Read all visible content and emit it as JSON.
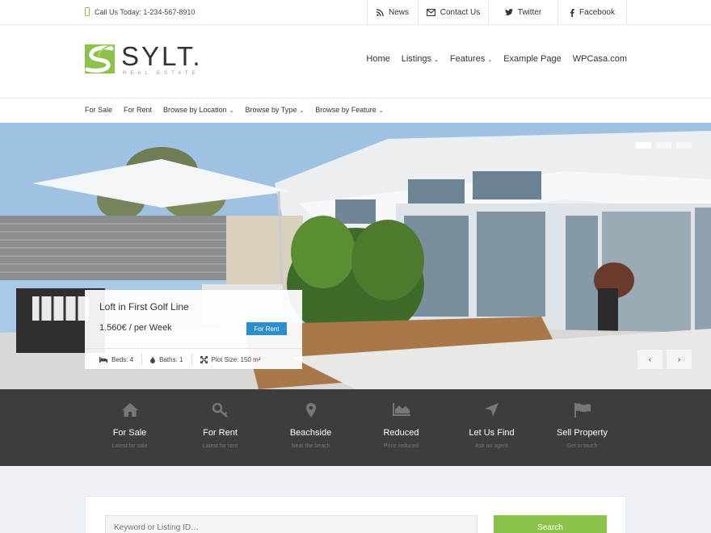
{
  "topbar": {
    "phone": "Call Us Today: 1-234-567-8910",
    "links": [
      {
        "label": "News",
        "icon": "rss-icon"
      },
      {
        "label": "Contact Us",
        "icon": "envelope-icon"
      },
      {
        "label": "Twitter",
        "icon": "twitter-icon"
      },
      {
        "label": "Facebook",
        "icon": "facebook-icon"
      }
    ]
  },
  "logo": {
    "title": "SYLT.",
    "subtitle": "REAL ESTATE"
  },
  "mainnav": [
    "Home",
    "Listings",
    "Features",
    "Example Page",
    "WPCasa.com"
  ],
  "subnav": [
    "For Sale",
    "For Rent",
    "Browse by Location",
    "Browse by Type",
    "Browse by Feature"
  ],
  "hero": {
    "prev_label": "‹",
    "next_label": "›",
    "slides": 3,
    "active_slide": 1,
    "listing": {
      "title": "Loft in First Golf Line",
      "price": "1.560€ / per Week",
      "badge": "For Rent",
      "beds": "Beds: 4",
      "baths": "Baths: 1",
      "plot": "Plot Size: 150 m²"
    }
  },
  "features": [
    {
      "title": "For Sale",
      "subtitle": "Latest for sale",
      "icon": "home-icon"
    },
    {
      "title": "For Rent",
      "subtitle": "Latest for rent",
      "icon": "key-icon"
    },
    {
      "title": "Beachside",
      "subtitle": "Near the beach",
      "icon": "map-pin-icon"
    },
    {
      "title": "Reduced",
      "subtitle": "Price reduced",
      "icon": "area-chart-icon"
    },
    {
      "title": "Let Us Find",
      "subtitle": "Ask an agent",
      "icon": "location-arrow-icon"
    },
    {
      "title": "Sell Property",
      "subtitle": "Get in touch",
      "icon": "flag-icon"
    }
  ],
  "search": {
    "placeholder": "Keyword or Listing ID…",
    "button": "Search"
  },
  "colors": {
    "accent": "#8bc34a",
    "badge": "#2b8fcf",
    "band": "#3d3d3d"
  }
}
